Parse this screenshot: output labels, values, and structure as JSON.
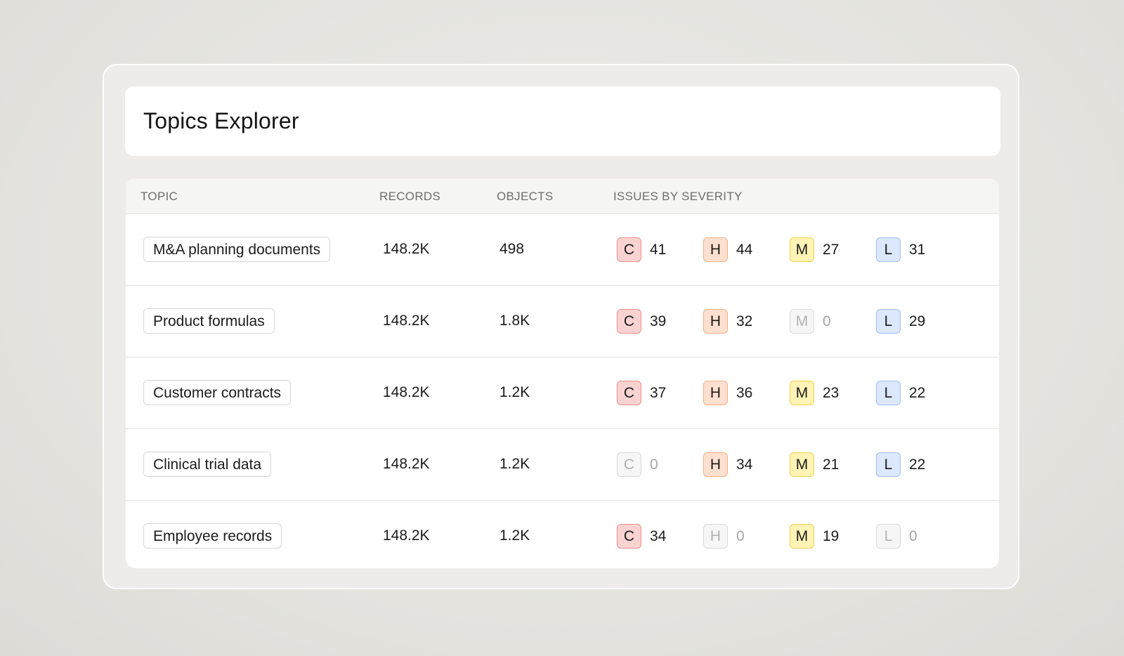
{
  "page": {
    "title": "Topics Explorer"
  },
  "table": {
    "columns": {
      "topic": "TOPIC",
      "records": "RECORDS",
      "objects": "OBJECTS",
      "issues": "ISSUES BY SEVERITY"
    },
    "severity_letters": {
      "critical": "C",
      "high": "H",
      "medium": "M",
      "low": "L"
    },
    "rows": [
      {
        "topic": "M&A planning documents",
        "records": "148.2K",
        "objects": "498",
        "c": "41",
        "h": "44",
        "m": "27",
        "l": "31"
      },
      {
        "topic": "Product formulas",
        "records": "148.2K",
        "objects": "1.8K",
        "c": "39",
        "h": "32",
        "m": "0",
        "l": "29"
      },
      {
        "topic": "Customer contracts",
        "records": "148.2K",
        "objects": "1.2K",
        "c": "37",
        "h": "36",
        "m": "23",
        "l": "22"
      },
      {
        "topic": "Clinical trial data",
        "records": "148.2K",
        "objects": "1.2K",
        "c": "0",
        "h": "34",
        "m": "21",
        "l": "22"
      },
      {
        "topic": "Employee records",
        "records": "148.2K",
        "objects": "1.2K",
        "c": "34",
        "h": "0",
        "m": "19",
        "l": "0"
      }
    ]
  },
  "colors": {
    "critical_bg": "#f9d3d2",
    "high_bg": "#fde0cf",
    "medium_bg": "#fff3b5",
    "low_bg": "#dce8fd",
    "zero_bg": "#f6f6f6"
  }
}
